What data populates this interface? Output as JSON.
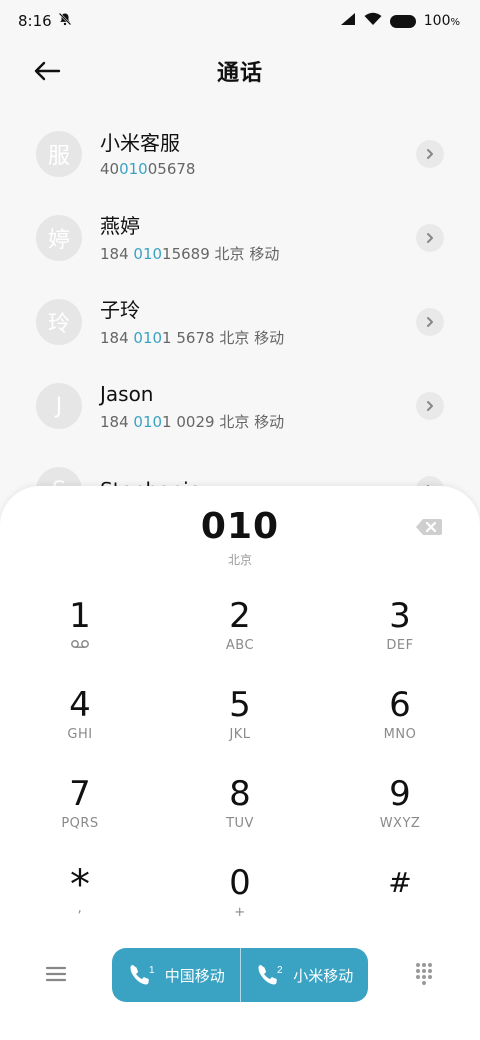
{
  "status": {
    "time": "8:16",
    "battery": "100"
  },
  "header": {
    "title": "通话"
  },
  "contacts": [
    {
      "initial": "服",
      "name": "小米客服",
      "num_pre": "40",
      "num_hl": "010",
      "num_post": "05678",
      "location": ""
    },
    {
      "initial": "婷",
      "name": "燕婷",
      "num_pre": "184 ",
      "num_hl": "010",
      "num_post": "15689",
      "location": "北京 移动"
    },
    {
      "initial": "玲",
      "name": "子玲",
      "num_pre": "184 ",
      "num_hl": "010",
      "num_post": "1 5678",
      "location": "北京 移动"
    },
    {
      "initial": "J",
      "name": "Jason",
      "num_pre": "184 ",
      "num_hl": "010",
      "num_post": "1 0029",
      "location": "北京 移动"
    },
    {
      "initial": "S",
      "name": "Stephanie",
      "num_pre": "",
      "num_hl": "",
      "num_post": "",
      "location": ""
    }
  ],
  "dialer": {
    "number": "010",
    "location": "北京",
    "keys": [
      {
        "digit": "1",
        "letters": ""
      },
      {
        "digit": "2",
        "letters": "ABC"
      },
      {
        "digit": "3",
        "letters": "DEF"
      },
      {
        "digit": "4",
        "letters": "GHI"
      },
      {
        "digit": "5",
        "letters": "JKL"
      },
      {
        "digit": "6",
        "letters": "MNO"
      },
      {
        "digit": "7",
        "letters": "PQRS"
      },
      {
        "digit": "8",
        "letters": "TUV"
      },
      {
        "digit": "9",
        "letters": "WXYZ"
      },
      {
        "digit": "*",
        "letters": ","
      },
      {
        "digit": "0",
        "letters": "+"
      },
      {
        "digit": "#",
        "letters": ""
      }
    ]
  },
  "call_buttons": [
    {
      "sim": "1",
      "label": "中国移动"
    },
    {
      "sim": "2",
      "label": "小米移动"
    }
  ],
  "colors": {
    "accent": "#3aa3c3"
  },
  "icons": [
    "bell-off-icon",
    "signal-icon",
    "wifi-icon",
    "battery-icon",
    "back-arrow-icon",
    "chevron-right-icon",
    "backspace-icon",
    "voicemail-icon",
    "menu-icon",
    "phone-icon",
    "keypad-icon"
  ]
}
